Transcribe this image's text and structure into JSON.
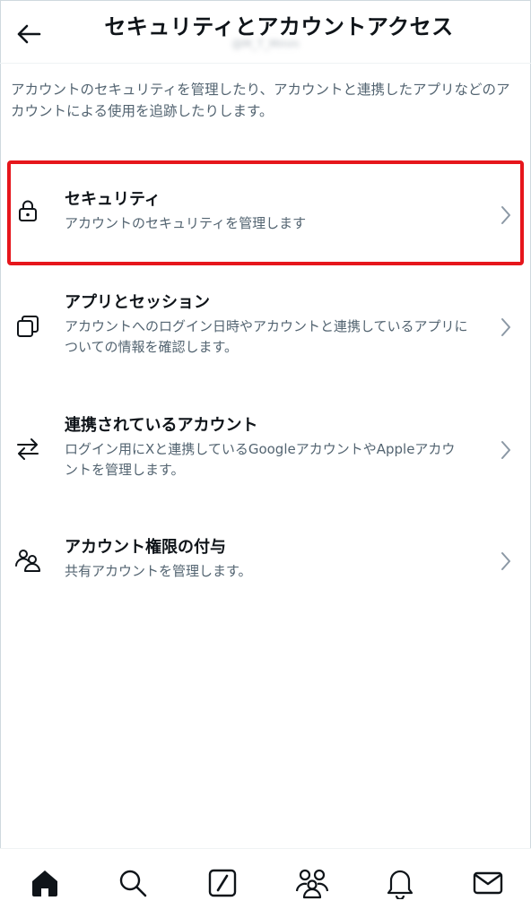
{
  "header": {
    "title": "セキュリティとアカウントアクセス",
    "handle": "@M_T_Mmm"
  },
  "intro": "アカウントのセキュリティを管理したり、アカウントと連携したアプリなどのアカウントによる使用を追跡したりします。",
  "items": [
    {
      "label": "セキュリティ",
      "desc": "アカウントのセキュリティを管理します",
      "icon": "lock-icon",
      "highlighted": true
    },
    {
      "label": "アプリとセッション",
      "desc": "アカウントへのログイン日時やアカウントと連携しているアプリについての情報を確認します。",
      "icon": "apps-sessions-icon"
    },
    {
      "label": "連携されているアカウント",
      "desc": "ログイン用にXと連携しているGoogleアカウントやAppleアカウントを管理します。",
      "icon": "swap-arrows-icon"
    },
    {
      "label": "アカウント権限の付与",
      "desc": "共有アカウントを管理します。",
      "icon": "people-icon"
    }
  ],
  "tabbar": [
    {
      "icon": "home-icon"
    },
    {
      "icon": "search-icon"
    },
    {
      "icon": "grok-icon"
    },
    {
      "icon": "communities-icon"
    },
    {
      "icon": "notifications-icon"
    },
    {
      "icon": "messages-icon"
    }
  ],
  "colors": {
    "text_primary": "#0f1419",
    "text_secondary": "#536471",
    "highlight_border": "#e6161c",
    "divider": "#eff3f4"
  }
}
